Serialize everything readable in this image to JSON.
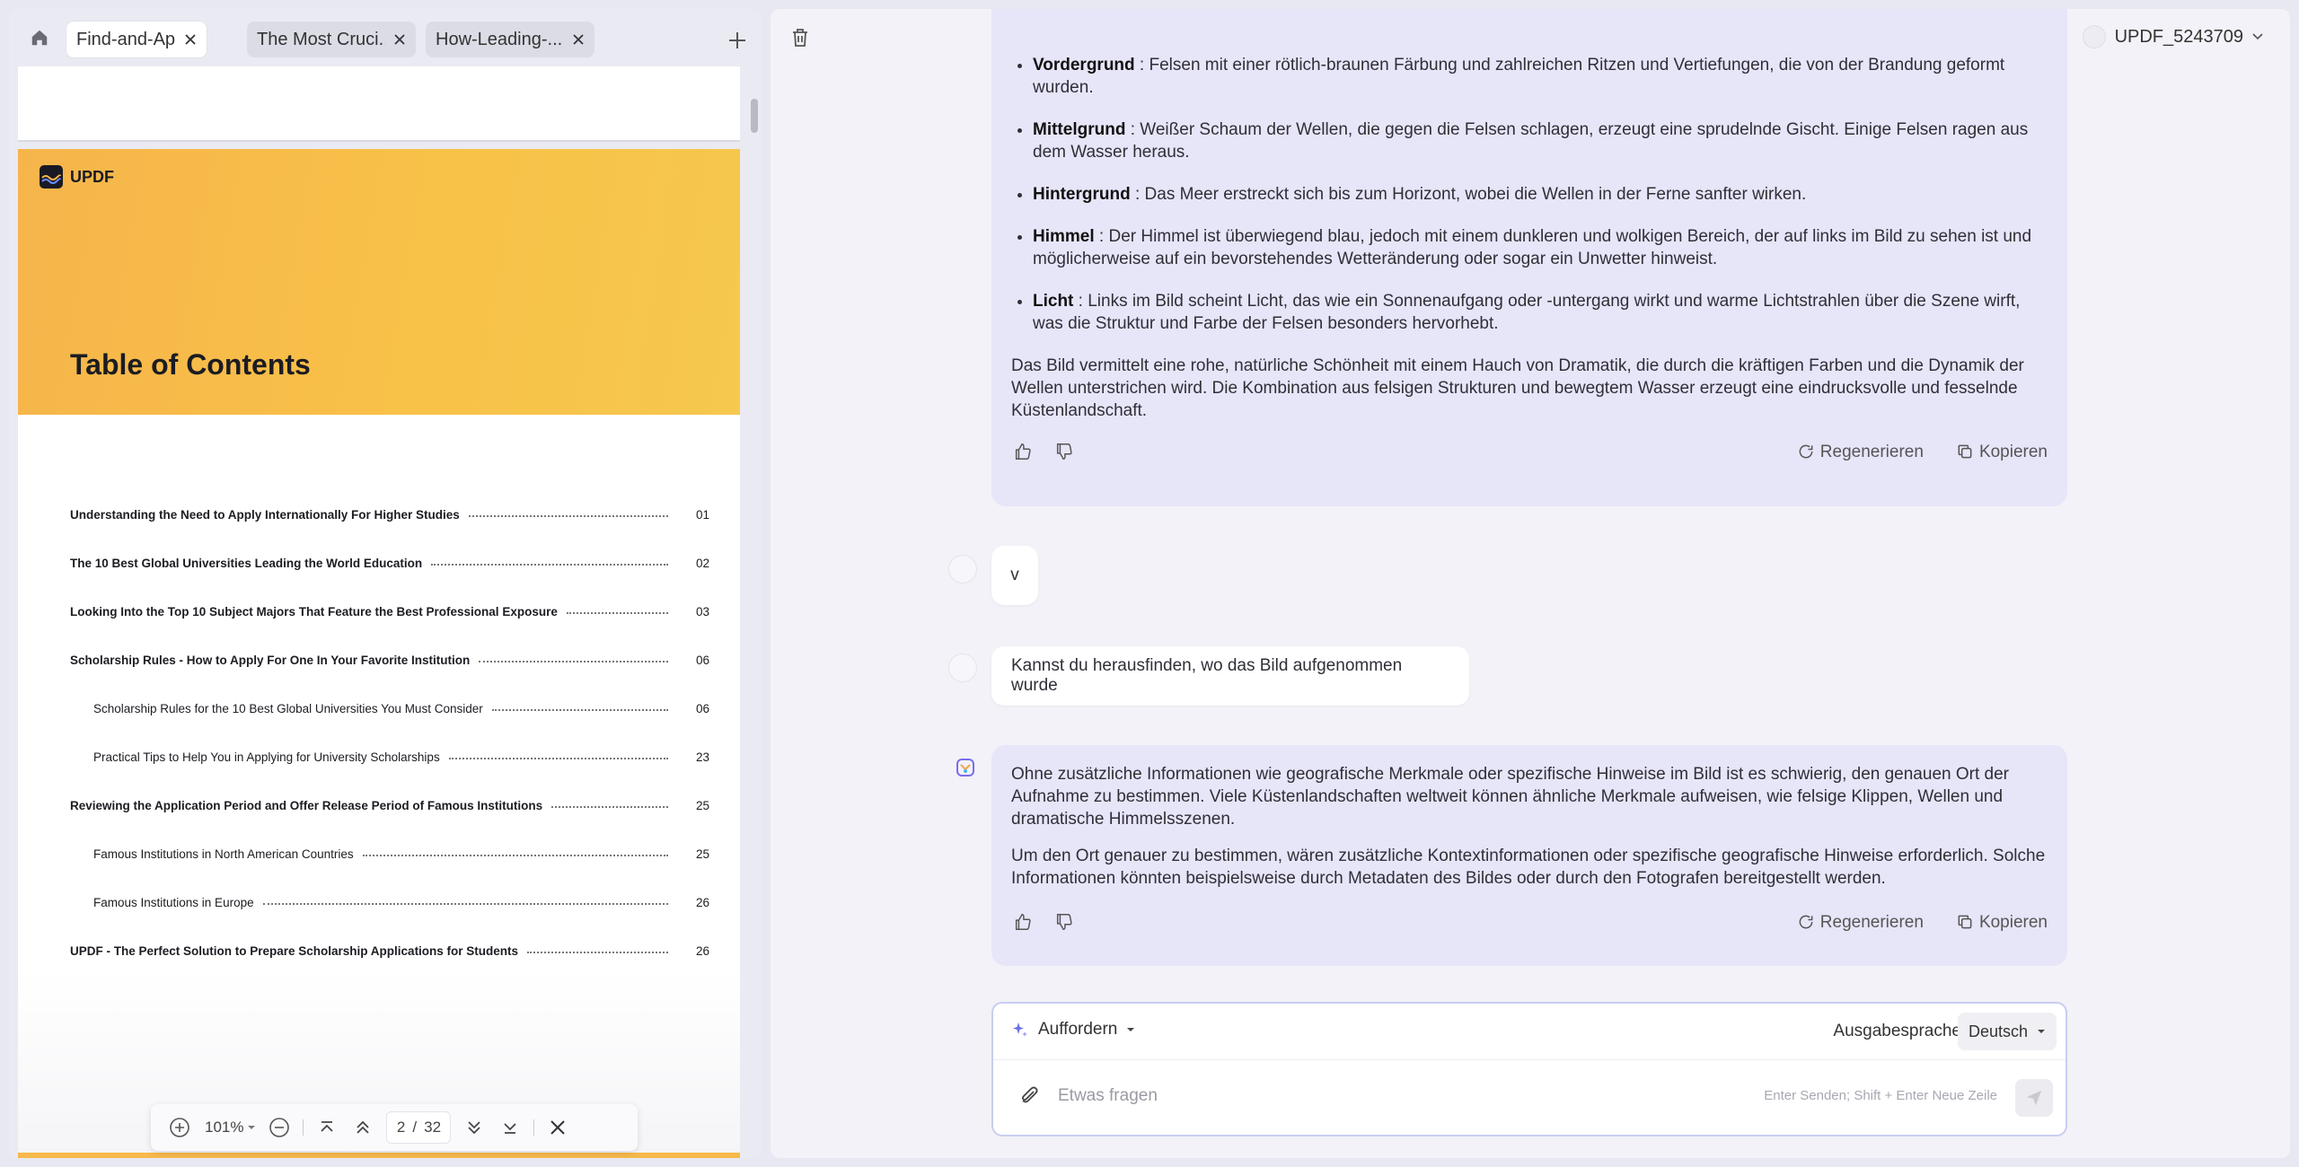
{
  "tabs": [
    {
      "label": "Find-and-Appl...",
      "active": true
    },
    {
      "label": "The Most Cruci...",
      "active": false
    },
    {
      "label": "How-Leading-...",
      "active": false
    }
  ],
  "document": {
    "logo_text": "UPDF",
    "toc_title": "Table of Contents",
    "toc": [
      {
        "text": "Understanding the Need to Apply Internationally For Higher Studies",
        "page": "01",
        "level": "main"
      },
      {
        "text": "The 10 Best Global Universities Leading the World Education",
        "page": "02",
        "level": "main"
      },
      {
        "text": "Looking Into the Top 10 Subject Majors That Feature the Best Professional Exposure",
        "page": "03",
        "level": "main"
      },
      {
        "text": "Scholarship Rules - How to Apply For One In Your Favorite Institution",
        "page": "06",
        "level": "main"
      },
      {
        "text": "Scholarship Rules for the 10 Best Global Universities You Must Consider",
        "page": "06",
        "level": "sub"
      },
      {
        "text": "Practical Tips to Help You in Applying for University Scholarships",
        "page": "23",
        "level": "sub"
      },
      {
        "text": "Reviewing the Application Period and Offer Release Period of Famous Institutions",
        "page": "25",
        "level": "main"
      },
      {
        "text": "Famous Institutions in North American Countries",
        "page": "25",
        "level": "sub"
      },
      {
        "text": "Famous Institutions in Europe",
        "page": "26",
        "level": "sub"
      },
      {
        "text": "UPDF - The Perfect Solution to Prepare Scholarship Applications for Students",
        "page": "26",
        "level": "main"
      }
    ]
  },
  "zoom_toolbar": {
    "zoom": "101%",
    "current_page": "2",
    "separator": "/",
    "total_pages": "32"
  },
  "header": {
    "username": "UPDF_5243709"
  },
  "chat": {
    "ai_message_1": {
      "bullets": [
        {
          "term": "Vordergrund",
          "text": " : Felsen mit einer rötlich-braunen Färbung und zahlreichen Ritzen und Vertiefungen, die von der Brandung geformt wurden."
        },
        {
          "term": "Mittelgrund",
          "text": " : Weißer Schaum der Wellen, die gegen die Felsen schlagen, erzeugt eine sprudelnde Gischt. Einige Felsen ragen aus dem Wasser heraus."
        },
        {
          "term": "Hintergrund",
          "text": " : Das Meer erstreckt sich bis zum Horizont, wobei die Wellen in der Ferne sanfter wirken."
        },
        {
          "term": "Himmel",
          "text": " : Der Himmel ist überwiegend blau, jedoch mit einem dunkleren und wolkigen Bereich, der auf links im Bild zu sehen ist und möglicherweise auf ein bevorstehendes Wetteränderung oder sogar ein Unwetter hinweist."
        },
        {
          "term": "Licht",
          "text": " : Links im Bild scheint Licht, das wie ein Sonnenaufgang oder -untergang wirkt und warme Lichtstrahlen über die Szene wirft, was die Struktur und Farbe der Felsen besonders hervorhebt."
        }
      ],
      "paragraph": "Das Bild vermittelt eine rohe, natürliche Schönheit mit einem Hauch von Dramatik, die durch die kräftigen Farben und die Dynamik der Wellen unterstrichen wird. Die Kombination aus felsigen Strukturen und bewegtem Wasser erzeugt eine eindrucksvolle und fesselnde Küstenlandschaft."
    },
    "user_message_1": "v",
    "user_message_2": "Kannst du herausfinden, wo das Bild aufgenommen wurde",
    "ai_message_2": {
      "paragraphs": [
        "Ohne zusätzliche Informationen wie geografische Merkmale oder spezifische Hinweise im Bild ist es schwierig, den genauen Ort der Aufnahme zu bestimmen. Viele Küstenlandschaften weltweit können ähnliche Merkmale aufweisen, wie felsige Klippen, Wellen und dramatische Himmelsszenen.",
        "Um den Ort genauer zu bestimmen, wären zusätzliche Kontextinformationen oder spezifische geografische Hinweise erforderlich. Solche Informationen könnten beispielsweise durch Metadaten des Bildes oder durch den Fotografen bereitgestellt werden."
      ]
    },
    "actions": {
      "regenerate": "Regenerieren",
      "copy": "Kopieren"
    }
  },
  "composer": {
    "prompt_label": "Auffordern",
    "output_language_label": "Ausgabesprache",
    "language": "Deutsch",
    "placeholder": "Etwas fragen",
    "hint": "Enter Senden; Shift + Enter Neue Zeile"
  },
  "colors": {
    "accent": "#6b6fe0",
    "ai_bubble": "#e7e5f8",
    "cover_yellow": "#f8c148"
  }
}
